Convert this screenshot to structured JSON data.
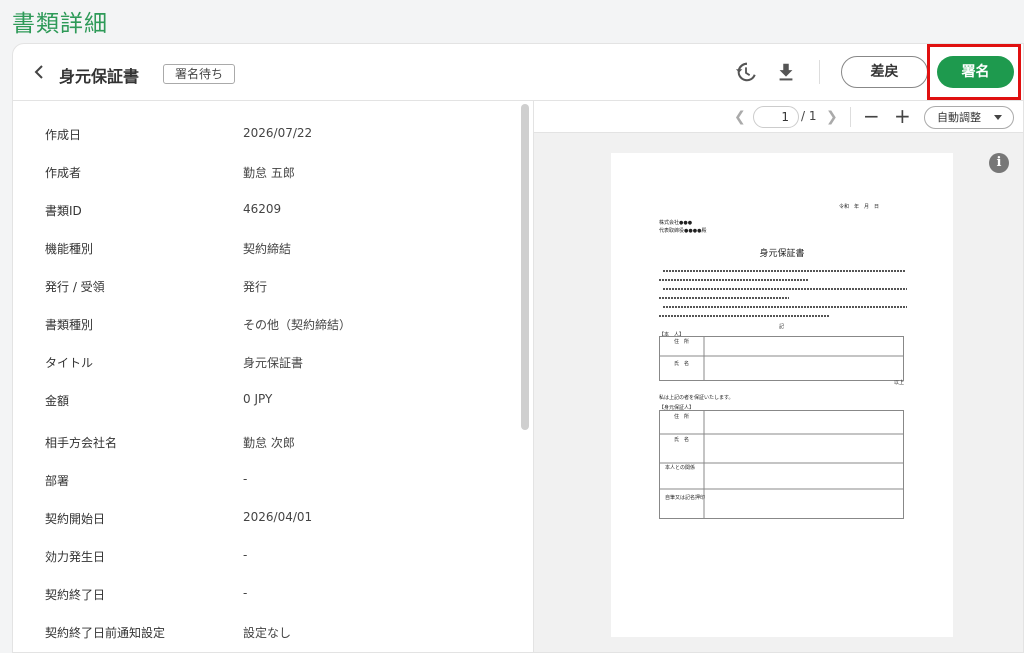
{
  "page": {
    "title": "書類詳細"
  },
  "header": {
    "doc_title": "身元保証書",
    "status_badge": "署名待ち",
    "return_label": "差戻",
    "sign_label": "署名"
  },
  "details": [
    {
      "label": "作成日",
      "value": "2026/07/22"
    },
    {
      "label": "作成者",
      "value": "勤怠 五郎"
    },
    {
      "label": "書類ID",
      "value": "46209"
    },
    {
      "label": "機能種別",
      "value": "契約締結"
    },
    {
      "label": "発行 / 受領",
      "value": "発行"
    },
    {
      "label": "書類種別",
      "value": "その他（契約締結）"
    },
    {
      "label": "タイトル",
      "value": "身元保証書"
    },
    {
      "label": "金額",
      "value": "0 JPY"
    },
    {
      "label": "相手方会社名",
      "value": "勤怠 次郎"
    },
    {
      "label": "部署",
      "value": "-"
    },
    {
      "label": "契約開始日",
      "value": "2026/04/01"
    },
    {
      "label": "効力発生日",
      "value": "-"
    },
    {
      "label": "契約終了日",
      "value": "-"
    },
    {
      "label": "契約終了日前通知設定",
      "value": "設定なし"
    }
  ],
  "viewer": {
    "page_current": "1",
    "page_total": "/ 1",
    "fit_label": "自動調整",
    "document": {
      "title": "身元保証書",
      "date_line": "令和　年　月　日",
      "company": "株式会社●●●",
      "representative": "代表取締役●●●●殿",
      "section_person": "【本　人】",
      "row_address": "住　所",
      "row_name": "氏　名",
      "end_mark": "以上",
      "guarantor_line": "私は上記の者を保証いたします。",
      "section_guarantor": "【身元保証人】",
      "row_relation": "本人との関係",
      "row_sign": "自筆又は記名押印",
      "note_mark": "記"
    }
  },
  "icons": {
    "back": "chevron-left-icon",
    "history": "history-icon",
    "download": "download-icon",
    "info": "info-icon"
  },
  "colors": {
    "accent": "#1e9a4e",
    "title": "#2e9a58",
    "highlight": "#e01010"
  }
}
